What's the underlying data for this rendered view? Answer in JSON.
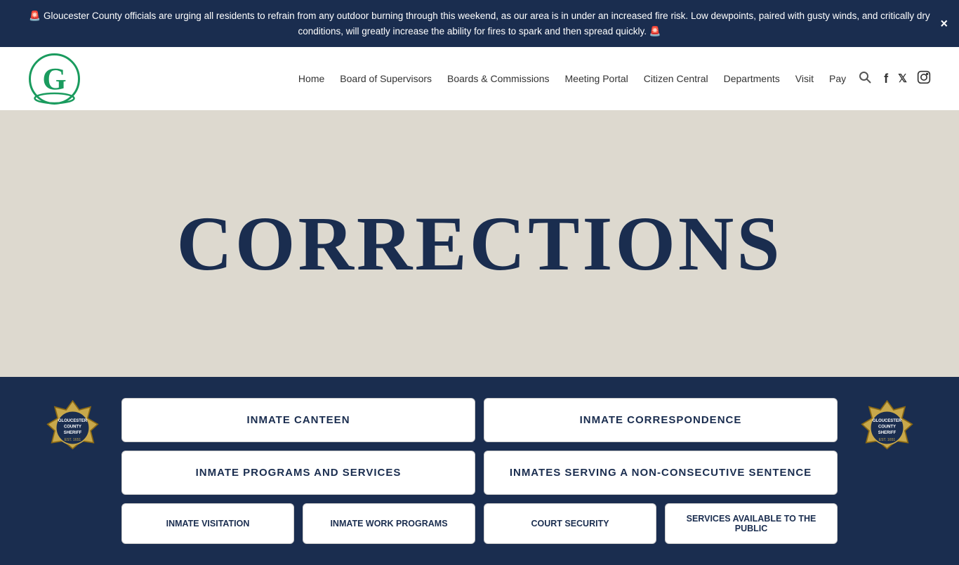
{
  "alert": {
    "text": "🚨 Gloucester County officials are urging all residents to refrain from any outdoor burning through this weekend, as our area is in under an increased fire risk. Low dewpoints, paired with gusty winds, and critically dry conditions, will greatly increase the ability for fires to spark and then spread quickly. 🚨",
    "close_label": "×"
  },
  "nav": {
    "links": [
      {
        "label": "Home",
        "name": "home-nav"
      },
      {
        "label": "Board of Supervisors",
        "name": "board-of-supervisors-nav"
      },
      {
        "label": "Boards & Commissions",
        "name": "boards-commissions-nav"
      },
      {
        "label": "Meeting Portal",
        "name": "meeting-portal-nav"
      },
      {
        "label": "Citizen Central",
        "name": "citizen-central-nav"
      },
      {
        "label": "Departments",
        "name": "departments-nav"
      },
      {
        "label": "Visit",
        "name": "visit-nav"
      },
      {
        "label": "Pay",
        "name": "pay-nav"
      }
    ]
  },
  "hero": {
    "title": "CORRECTIONS"
  },
  "cards": [
    {
      "label": "INMATE CANTEEN",
      "name": "inmate-canteen-card"
    },
    {
      "label": "INMATE CORRESPONDENCE",
      "name": "inmate-correspondence-card"
    },
    {
      "label": "INMATE PROGRAMS AND SERVICES",
      "name": "inmate-programs-card"
    },
    {
      "label": "INMATES SERVING A NON-CONSECUTIVE SENTENCE",
      "name": "inmates-non-consecutive-card"
    }
  ],
  "bottom_links": [
    {
      "label": "Inmate Visitation",
      "name": "inmate-visitation-link"
    },
    {
      "label": "Inmate Work Programs",
      "name": "inmate-work-link"
    },
    {
      "label": "Court Security",
      "name": "court-security-link"
    },
    {
      "label": "Services Available to the Public",
      "name": "services-public-link"
    }
  ]
}
